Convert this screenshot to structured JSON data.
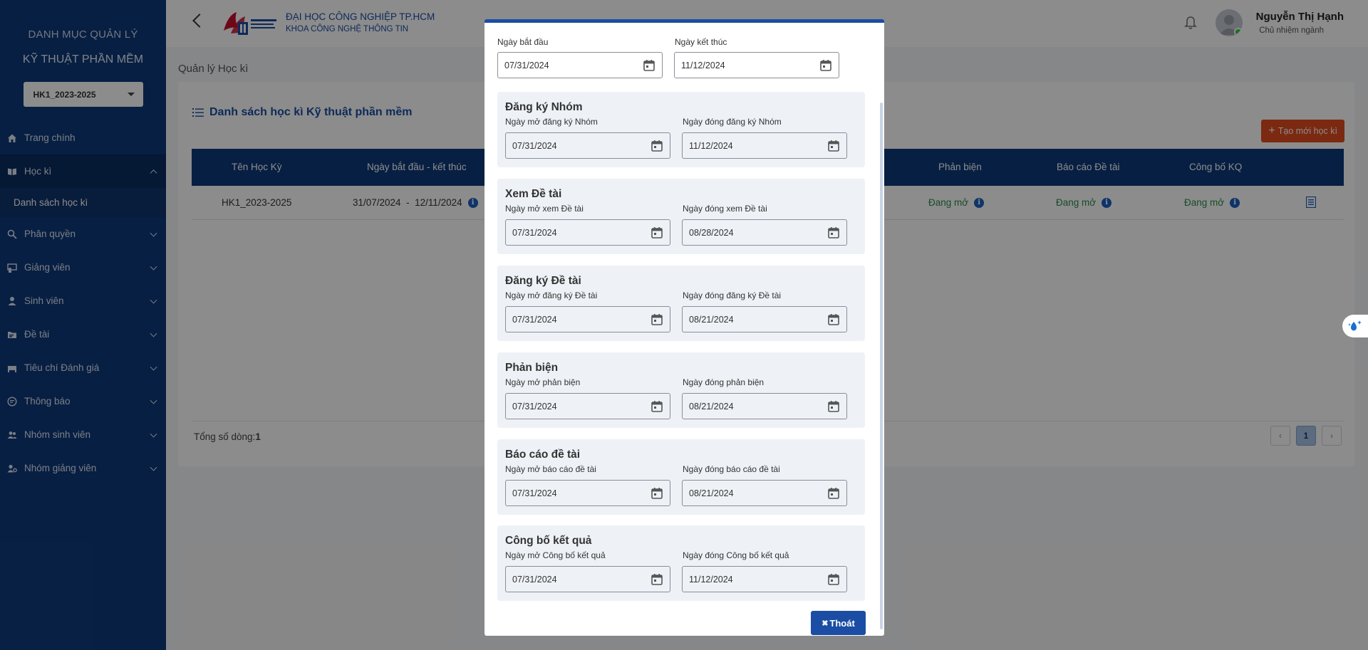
{
  "sidebar": {
    "title1": "DANH MỤC QUẢN LÝ",
    "title2": "KỸ THUẬT PHẦN MỀM",
    "semester_select": "HK1_2023-2025",
    "items": [
      {
        "label": "Trang chính"
      },
      {
        "label": "Học kì"
      },
      {
        "label": "Phân quyền"
      },
      {
        "label": "Giảng viên"
      },
      {
        "label": "Sinh viên"
      },
      {
        "label": "Đề tài"
      },
      {
        "label": "Tiêu chí Đánh giá"
      },
      {
        "label": "Thông báo"
      },
      {
        "label": "Nhóm sinh viên"
      },
      {
        "label": "Nhóm giảng viên"
      }
    ],
    "sub_item": "Danh sách học kì"
  },
  "header": {
    "university": "ĐẠI HỌC CÔNG NGHIỆP TP.HCM",
    "faculty": "KHOA CÔNG NGHỆ THÔNG TIN",
    "user_name": "Nguyễn Thị Hạnh",
    "user_role": "Chủ nhiệm ngành"
  },
  "main": {
    "breadcrumb": "Quản lý Học kì",
    "card_title": "Danh sách học kì Kỹ thuật phần mềm",
    "create_button": "Tạo mới học kì",
    "columns": [
      "Tên Học Kỳ",
      "Ngày bắt đầu - kết thúc",
      "Phản biện",
      "Báo cáo Đề tài",
      "Công bố KQ"
    ],
    "row": {
      "name": "HK1_2023-2025",
      "dates": "31/07/2024  -  12/11/2024",
      "review": "Đang mở",
      "report": "Đang mở",
      "publish": "Đang mở"
    },
    "total_label": "Tổng số dòng:",
    "total_value": "1",
    "current_page": "1"
  },
  "modal": {
    "start_label": "Ngày bắt đầu",
    "start_value": "07/31/2024",
    "end_label": "Ngày kết thúc",
    "end_value": "11/12/2024",
    "sections": [
      {
        "title": "Đăng ký Nhóm",
        "open_label": "Ngày mở đăng ký Nhóm",
        "open_value": "07/31/2024",
        "close_label": "Ngày đóng đăng ký Nhóm",
        "close_value": "11/12/2024"
      },
      {
        "title": "Xem Đề tài",
        "open_label": "Ngày mở xem Đề tài",
        "open_value": "07/31/2024",
        "close_label": "Ngày đóng xem Đề tài",
        "close_value": "08/28/2024"
      },
      {
        "title": "Đăng ký Đề tài",
        "open_label": "Ngày mở đăng ký Đề tài",
        "open_value": "07/31/2024",
        "close_label": "Ngày đóng đăng ký Đề tài",
        "close_value": "08/21/2024"
      },
      {
        "title": "Phản biện",
        "open_label": "Ngày mở phản biện",
        "open_value": "07/31/2024",
        "close_label": "Ngày đóng phản biện",
        "close_value": "08/21/2024"
      },
      {
        "title": "Báo cáo đề tài",
        "open_label": "Ngày mở báo cáo đề tài",
        "open_value": "07/31/2024",
        "close_label": "Ngày đóng báo cáo đề tài",
        "close_value": "08/21/2024"
      },
      {
        "title": "Công bố kết quả",
        "open_label": "Ngày mở Công bố kết quả",
        "open_value": "07/31/2024",
        "close_label": "Ngày đóng Công bố kết quả",
        "close_value": "11/12/2024"
      }
    ],
    "exit_button": "Thoát"
  }
}
